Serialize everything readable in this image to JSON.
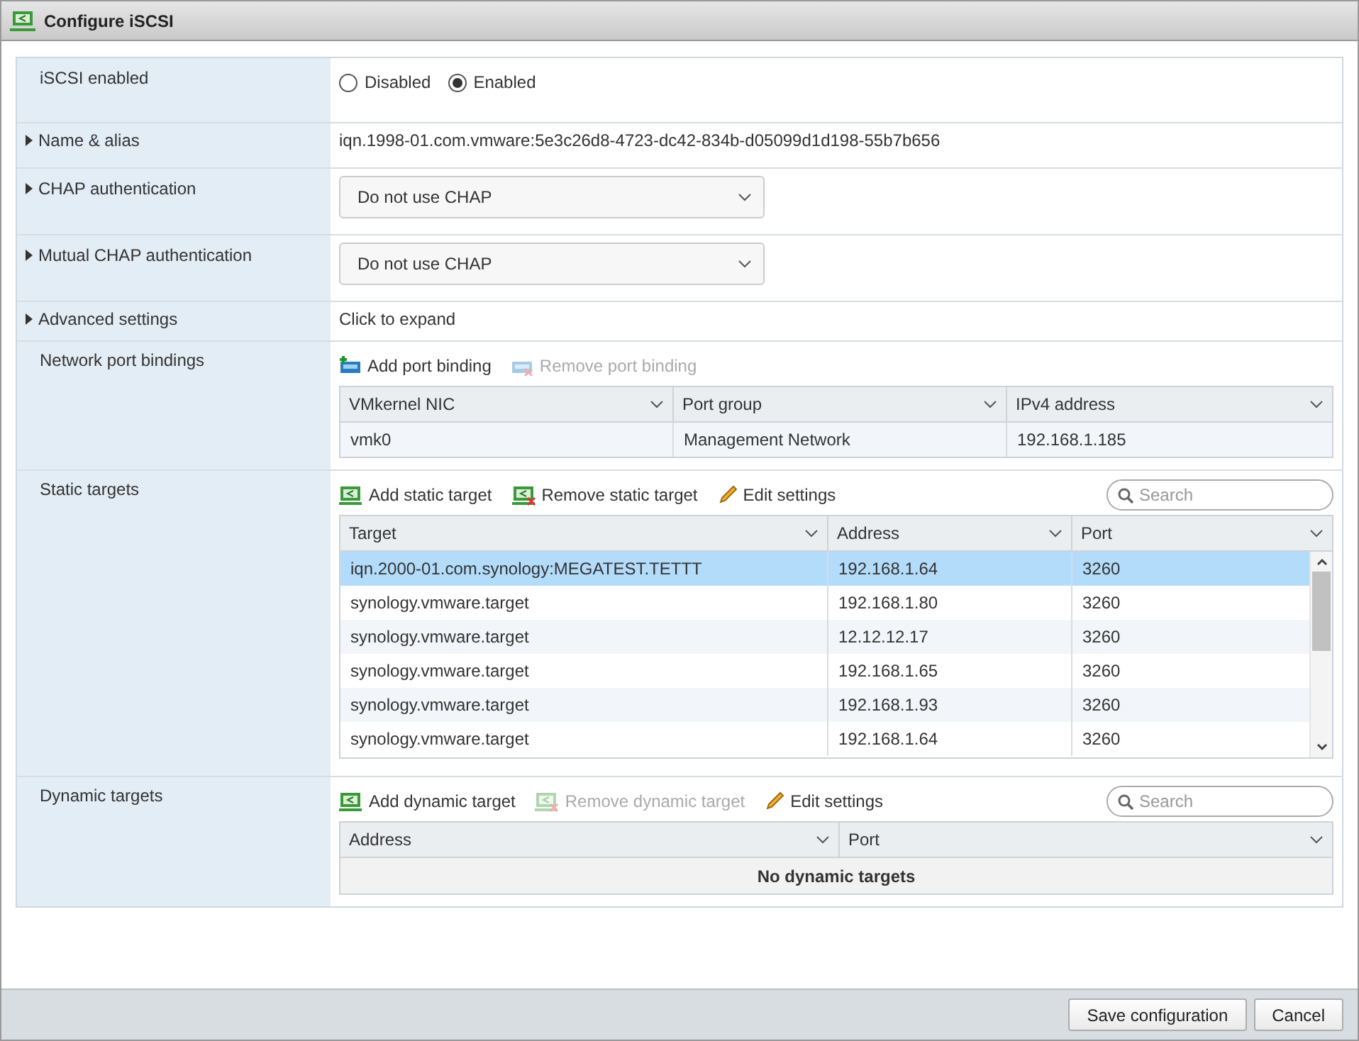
{
  "window": {
    "title": "Configure iSCSI"
  },
  "sections": [
    {
      "kind": "radio",
      "label": "iSCSI enabled",
      "expandable": false,
      "options": [
        {
          "label": "Disabled",
          "selected": false
        },
        {
          "label": "Enabled",
          "selected": true
        }
      ]
    },
    {
      "kind": "text",
      "label": "Name & alias",
      "expandable": true,
      "value": "iqn.1998-01.com.vmware:5e3c26d8-4723-dc42-834b-d05099d1d198-55b7b656"
    },
    {
      "kind": "select",
      "label": "CHAP authentication",
      "expandable": true,
      "value": "Do not use CHAP"
    },
    {
      "kind": "select",
      "label": "Mutual CHAP authentication",
      "expandable": true,
      "value": "Do not use CHAP"
    },
    {
      "kind": "text",
      "label": "Advanced settings",
      "expandable": true,
      "value": "Click to expand"
    },
    {
      "kind": "table",
      "label": "Network port bindings",
      "expandable": false,
      "actions": [
        {
          "kind": "add-nic",
          "label": "Add port binding",
          "disabled": false
        },
        {
          "kind": "remove-nic",
          "label": "Remove port binding",
          "disabled": true
        }
      ],
      "columns": [
        "VMkernel NIC",
        "Port group",
        "IPv4 address"
      ],
      "rows": [
        {
          "cells": [
            "vmk0",
            "Management Network",
            "192.168.1.185"
          ],
          "selected": false
        }
      ]
    },
    {
      "kind": "table",
      "label": "Static targets",
      "expandable": false,
      "search": {
        "placeholder": "Search"
      },
      "scrollable": true,
      "actions": [
        {
          "kind": "add-target",
          "label": "Add static target",
          "disabled": false
        },
        {
          "kind": "remove-target",
          "label": "Remove static target",
          "disabled": false
        },
        {
          "kind": "edit",
          "label": "Edit settings",
          "disabled": false
        }
      ],
      "columns": [
        "Target",
        "Address",
        "Port"
      ],
      "rows": [
        {
          "cells": [
            "iqn.2000-01.com.synology:MEGATEST.TETTT",
            "192.168.1.64",
            "3260"
          ],
          "selected": true
        },
        {
          "cells": [
            "synology.vmware.target",
            "192.168.1.80",
            "3260"
          ],
          "selected": false
        },
        {
          "cells": [
            "synology.vmware.target",
            "12.12.12.17",
            "3260"
          ],
          "selected": false
        },
        {
          "cells": [
            "synology.vmware.target",
            "192.168.1.65",
            "3260"
          ],
          "selected": false
        },
        {
          "cells": [
            "synology.vmware.target",
            "192.168.1.93",
            "3260"
          ],
          "selected": false
        },
        {
          "cells": [
            "synology.vmware.target",
            "192.168.1.64",
            "3260"
          ],
          "selected": false
        }
      ]
    },
    {
      "kind": "table",
      "label": "Dynamic targets",
      "expandable": false,
      "search": {
        "placeholder": "Search"
      },
      "actions": [
        {
          "kind": "add-target",
          "label": "Add dynamic target",
          "disabled": false
        },
        {
          "kind": "remove-target",
          "label": "Remove dynamic target",
          "disabled": true
        },
        {
          "kind": "edit",
          "label": "Edit settings",
          "disabled": false
        }
      ],
      "columns": [
        "Address",
        "Port"
      ],
      "empty_message": "No dynamic targets"
    }
  ],
  "buttons": [
    {
      "label": "Save configuration"
    },
    {
      "label": "Cancel"
    }
  ]
}
